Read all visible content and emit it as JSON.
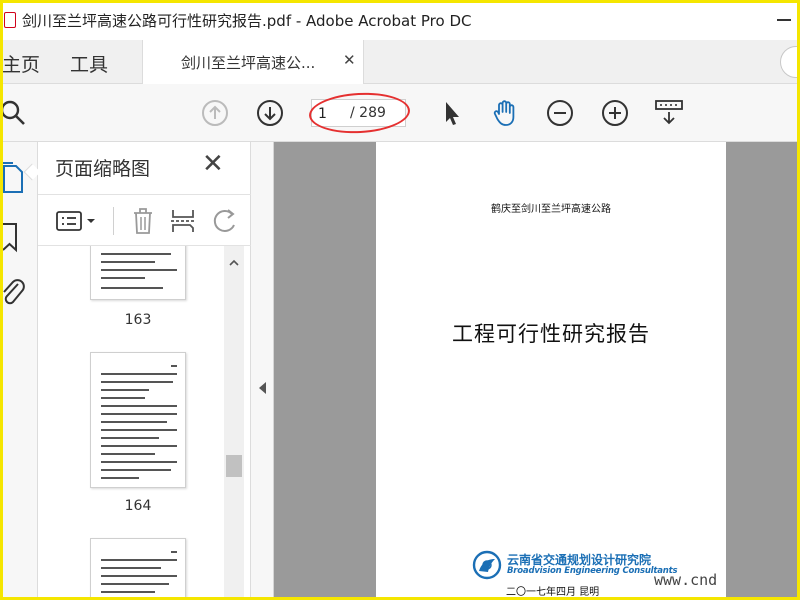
{
  "window": {
    "title": "剑川至兰坪高速公路可行性研究报告.pdf - Adobe Acrobat Pro DC"
  },
  "tabs": {
    "home_label": "主页",
    "tools_label": "工具",
    "doc_label": "剑川至兰坪高速公..."
  },
  "toolbar": {
    "current_page": "1",
    "total_pages": "/ 289"
  },
  "thumbnail_panel": {
    "title": "页面缩略图",
    "pages": [
      {
        "label": "163"
      },
      {
        "label": "164"
      },
      {
        "label": ""
      }
    ]
  },
  "document": {
    "subtitle": "鹤庆至剑川至兰坪高速公路",
    "title": "工程可行性研究报告",
    "org_cn": "云南省交通规划设计研究院",
    "org_en": "Broadvision Engineering Consultants",
    "date": "二〇一七年四月   昆明"
  },
  "watermark": "www.cnd",
  "colors": {
    "accent_blue": "#1b6fb5",
    "annotation_red": "#e53030",
    "frame_yellow": "#f5e600"
  }
}
